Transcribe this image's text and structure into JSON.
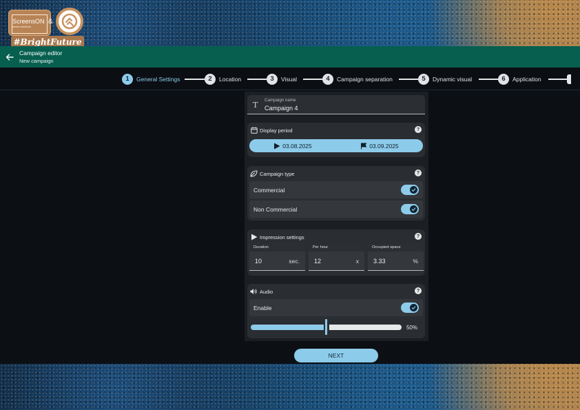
{
  "branding": {
    "logo_text": "ScreensON",
    "logo_sub": "smart solutions",
    "ampersand": "&",
    "hashtag": "#BrightFuture"
  },
  "appbar": {
    "title": "Campaign editor",
    "subtitle": "New campaign",
    "color": "#065f4f"
  },
  "stepper": {
    "steps": [
      {
        "num": "1",
        "label": "General Settings",
        "active": true
      },
      {
        "num": "2",
        "label": "Location",
        "active": false
      },
      {
        "num": "3",
        "label": "Visual",
        "active": false
      },
      {
        "num": "4",
        "label": "Campaign separation",
        "active": false
      },
      {
        "num": "5",
        "label": "Dynamic visual",
        "active": false
      },
      {
        "num": "6",
        "label": "Application",
        "active": false
      }
    ]
  },
  "campaign_name": {
    "label": "Campaign name",
    "value": "Campaign 4",
    "icon": "text-format-icon"
  },
  "display_period": {
    "title": "Display period",
    "start": "03.08.2025",
    "end": "03.09.2025",
    "help": "?"
  },
  "campaign_type": {
    "title": "Campaign type",
    "help": "?",
    "options": [
      {
        "label": "Commercial",
        "enabled": true
      },
      {
        "label": "Non Commercial",
        "enabled": true
      }
    ]
  },
  "impression_settings": {
    "title": "Impression settings",
    "help": "?",
    "fields": [
      {
        "label": "Duration",
        "value": "10",
        "unit": "sec."
      },
      {
        "label": "Per hour",
        "value": "12",
        "unit": "x"
      },
      {
        "label": "Occupied space",
        "value": "3.33",
        "unit": "%"
      }
    ]
  },
  "audio": {
    "title": "Audio",
    "help": "?",
    "enable_label": "Enable",
    "enabled": true,
    "volume_percent": 50,
    "volume_text": "50%"
  },
  "next_button": "NEXT",
  "colors": {
    "accent": "#8dcbea",
    "panel": "#1b1e22",
    "card": "#2a2d31"
  }
}
